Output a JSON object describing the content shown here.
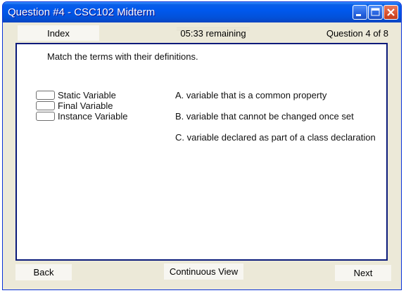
{
  "window": {
    "title": "Question #4 - CSC102 Midterm",
    "controls": {
      "minimize": "minimize-icon",
      "maximize": "maximize-icon",
      "close": "close-icon"
    }
  },
  "topbar": {
    "index_label": "Index",
    "timer": "05:33 remaining",
    "counter": "Question 4 of 8"
  },
  "question": {
    "instructions": "Match the terms with their definitions.",
    "terms": [
      {
        "label": "Static Variable",
        "answer": ""
      },
      {
        "label": "Final Variable",
        "answer": ""
      },
      {
        "label": "Instance Variable",
        "answer": ""
      }
    ],
    "definitions": [
      "A. variable that is a common property",
      "B. variable that cannot be changed once set",
      "C. variable declared as part of a class declaration"
    ]
  },
  "footer": {
    "back_label": "Back",
    "continuous_label": "Continuous View",
    "next_label": "Next"
  },
  "colors": {
    "titlebar": "#0058EE",
    "window_bg": "#ECE9D8",
    "content_border": "#0A1A7A",
    "close_button": "#D8512E"
  }
}
